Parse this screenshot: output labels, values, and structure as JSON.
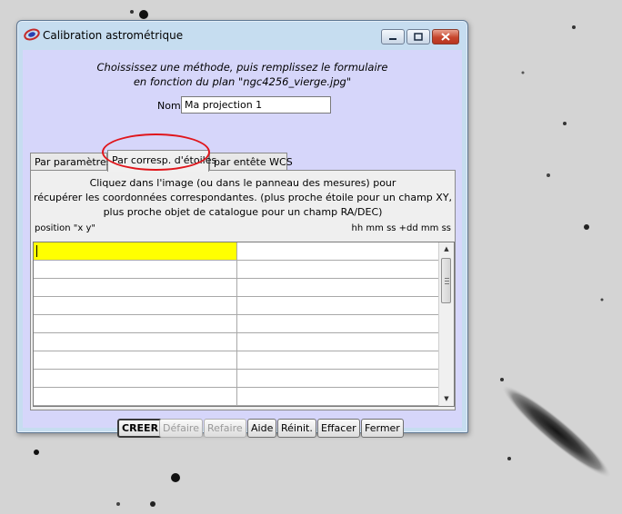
{
  "window": {
    "title": "Calibration astrométrique"
  },
  "instructions": {
    "line1": "Choississez une méthode, puis remplissez le formulaire",
    "line2": "en fonction du plan \"ngc4256_vierge.jpg\""
  },
  "name_field": {
    "label": "Nom:",
    "value": "Ma projection 1"
  },
  "tabs": [
    {
      "label": "Par paramètres",
      "selected": false
    },
    {
      "label": "Par corresp. d'étoiles",
      "selected": true
    },
    {
      "label": "par entête WCS",
      "selected": false
    }
  ],
  "panel": {
    "description_lines": [
      "Cliquez dans l'image (ou dans le panneau des mesures) pour",
      "récupérer les coordonnées correspondantes. (plus proche étoile pour un champ XY,",
      "plus proche objet de catalogue pour un champ RA/DEC)"
    ],
    "column_left": "position \"x y\"",
    "column_right": "hh mm ss +dd mm ss",
    "visible_rows": 10
  },
  "buttons": [
    {
      "label": "CREER",
      "enabled": true,
      "default": true
    },
    {
      "label": "Défaire",
      "enabled": false
    },
    {
      "label": "Refaire",
      "enabled": false
    },
    {
      "label": "Aide",
      "enabled": true
    },
    {
      "label": "Réinit.",
      "enabled": true
    },
    {
      "label": "Effacer",
      "enabled": true
    },
    {
      "label": "Fermer",
      "enabled": true
    }
  ],
  "colors": {
    "client_background": "#d6d6fa",
    "active_cell": "#ffff00",
    "highlight_ellipse": "#e0161c"
  }
}
